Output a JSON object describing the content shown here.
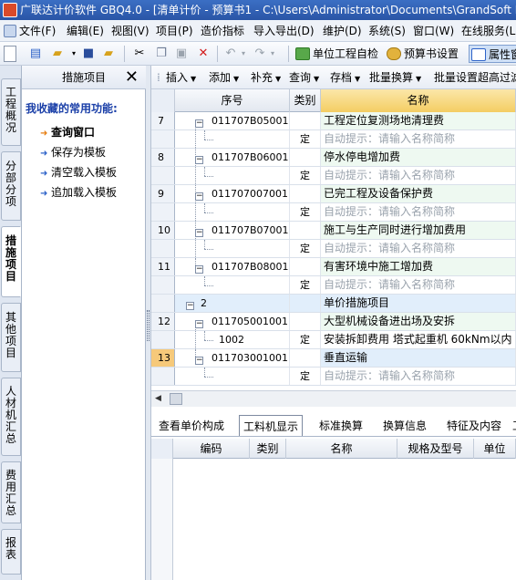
{
  "window": {
    "title": "广联达计价软件 GBQ4.0 - [清单计价 - 预算书1 - C:\\Users\\Administrator\\Documents\\GrandSoft P"
  },
  "menu": {
    "items": [
      "文件(F)",
      "编辑(E)",
      "视图(V)",
      "项目(P)",
      "造价指标",
      "导入导出(D)",
      "维护(D)",
      "系统(S)",
      "窗口(W)",
      "在线服务(L"
    ]
  },
  "toolbar": {
    "unit_check_label": "单位工程自检",
    "budget_settings_label": "预算书设置",
    "properties_label": "属性窗"
  },
  "left_tabs": [
    {
      "label": "工程概况"
    },
    {
      "label": "分部分项"
    },
    {
      "label": "措施项目"
    },
    {
      "label": "其他项目"
    },
    {
      "label": "人材机汇总"
    },
    {
      "label": "费用汇总"
    },
    {
      "label": "报表"
    }
  ],
  "panel": {
    "title": "措施项目",
    "close_symbol": "✕",
    "favorites_heading": "我收藏的常用功能:",
    "items": [
      {
        "label": "查询窗口",
        "selected": true
      },
      {
        "label": "保存为模板",
        "selected": false
      },
      {
        "label": "清空载入模板",
        "selected": false
      },
      {
        "label": "追加载入模板",
        "selected": false
      }
    ]
  },
  "subtoolbar": {
    "items": [
      "插入",
      "添加",
      "补充",
      "查询",
      "存档",
      "批量换算",
      "批量设置超高过滤"
    ]
  },
  "grid": {
    "headers": {
      "row_no": "",
      "code": "序号",
      "category": "类别",
      "name": "名称"
    },
    "rows": [
      {
        "no": "7",
        "code": "011707B05001",
        "category": "",
        "name": "工程定位复测场地清理费",
        "hint": false
      },
      {
        "no": "",
        "code": "",
        "category": "定",
        "name": "自动提示：请输入名称简称",
        "hint": true
      },
      {
        "no": "8",
        "code": "011707B06001",
        "category": "",
        "name": "停水停电增加费",
        "hint": false
      },
      {
        "no": "",
        "code": "",
        "category": "定",
        "name": "自动提示：请输入名称简称",
        "hint": true
      },
      {
        "no": "9",
        "code": "011707007001",
        "category": "",
        "name": "已完工程及设备保护费",
        "hint": false
      },
      {
        "no": "",
        "code": "",
        "category": "定",
        "name": "自动提示：请输入名称简称",
        "hint": true
      },
      {
        "no": "10",
        "code": "011707B07001",
        "category": "",
        "name": "施工与生产同时进行增加费用",
        "hint": false
      },
      {
        "no": "",
        "code": "",
        "category": "定",
        "name": "自动提示：请输入名称简称",
        "hint": true
      },
      {
        "no": "11",
        "code": "011707B08001",
        "category": "",
        "name": "有害环境中施工增加费",
        "hint": false
      },
      {
        "no": "",
        "code": "",
        "category": "定",
        "name": "自动提示：请输入名称简称",
        "hint": true
      },
      {
        "no": "",
        "code": "2",
        "category": "",
        "name": "单价措施项目",
        "hint": false
      },
      {
        "no": "12",
        "code": "011705001001",
        "category": "",
        "name": "大型机械设备进出场及安拆",
        "hint": false
      },
      {
        "no": "",
        "code": "1002",
        "category": "定",
        "name": "安装拆卸费用 塔式起重机 60kNm以内",
        "hint": false
      },
      {
        "no": "13",
        "code": "011703001001",
        "category": "",
        "name": "垂直运输",
        "hint": false
      },
      {
        "no": "",
        "code": "",
        "category": "定",
        "name": "自动提示：请输入名称简称",
        "hint": true
      }
    ]
  },
  "bottom_tabs": [
    "查看单价构成",
    "工料机显示",
    "标准换算",
    "换算信息",
    "特征及内容",
    "工"
  ],
  "bottom_grid": {
    "headers": [
      "编码",
      "类别",
      "名称",
      "规格及型号",
      "单位"
    ]
  }
}
